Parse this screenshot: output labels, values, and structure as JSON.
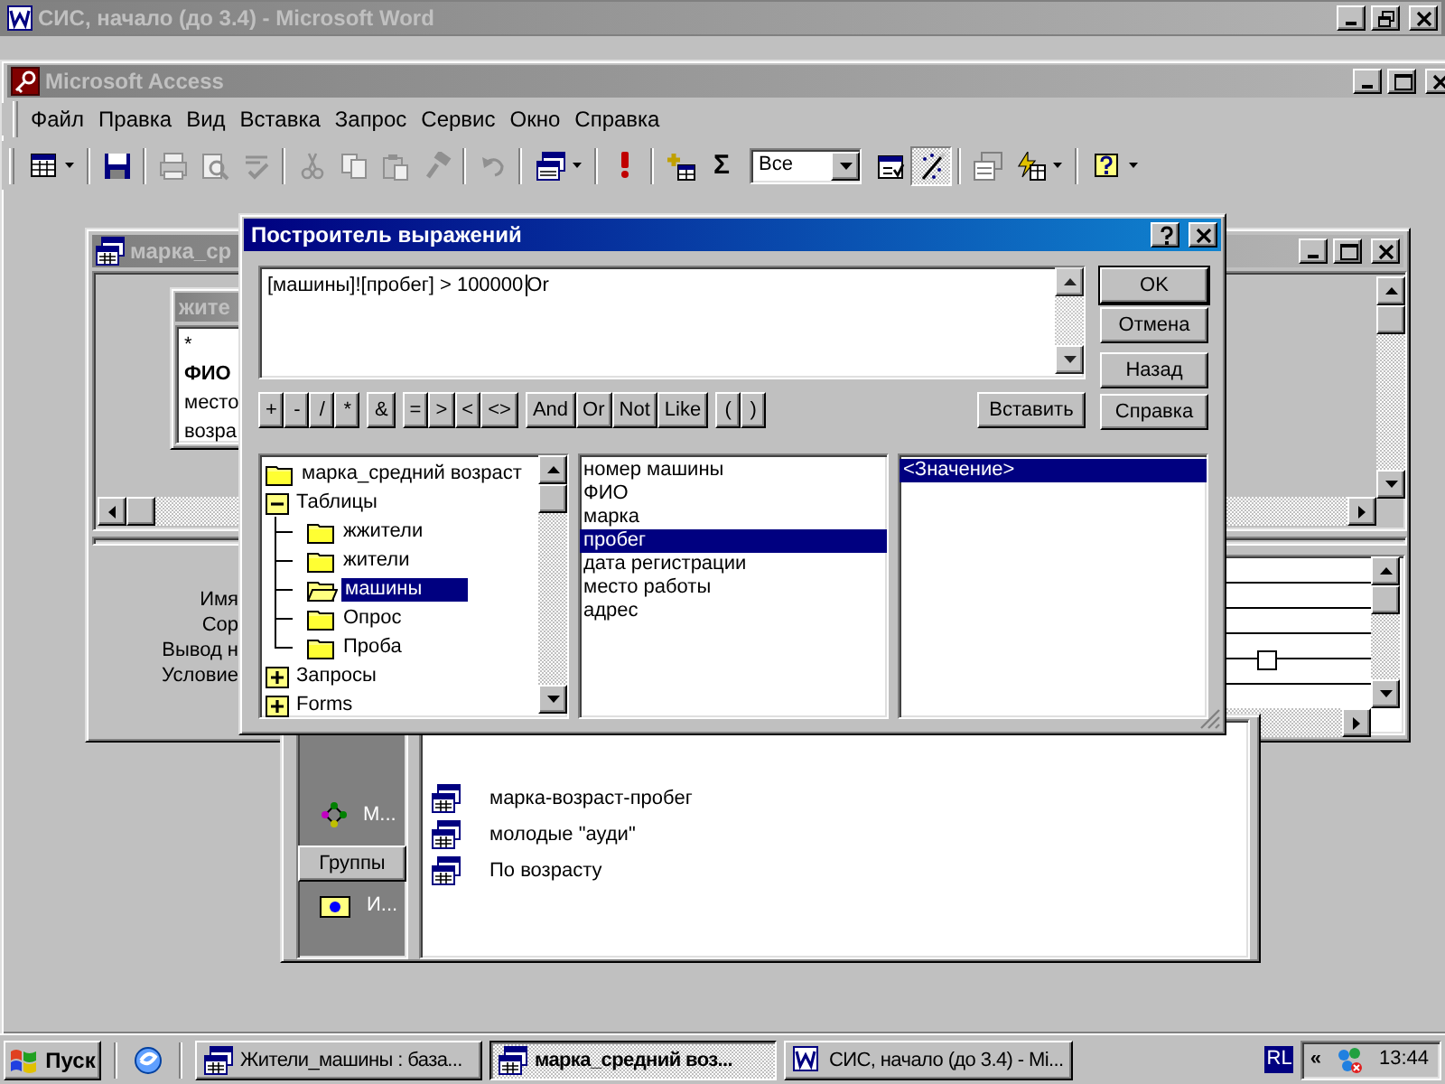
{
  "word_window": {
    "title": "СИС, начало (до 3.4) - Microsoft Word"
  },
  "access_window": {
    "title": "Microsoft Access",
    "menu": [
      "Файл",
      "Правка",
      "Вид",
      "Вставка",
      "Запрос",
      "Сервис",
      "Окно",
      "Справка"
    ],
    "toolbar": [
      {
        "kind": "view",
        "disabled": false,
        "pressed": false
      },
      {
        "kind": "separator"
      },
      {
        "kind": "save",
        "disabled": false,
        "pressed": false
      },
      {
        "kind": "separator"
      },
      {
        "kind": "print",
        "disabled": true,
        "pressed": false
      },
      {
        "kind": "preview",
        "disabled": true,
        "pressed": false
      },
      {
        "kind": "spell",
        "disabled": true,
        "pressed": false
      },
      {
        "kind": "separator"
      },
      {
        "kind": "cut",
        "disabled": true,
        "pressed": false
      },
      {
        "kind": "copy",
        "disabled": true,
        "pressed": false
      },
      {
        "kind": "paste",
        "disabled": true,
        "pressed": false
      },
      {
        "kind": "painter",
        "disabled": true,
        "pressed": false
      },
      {
        "kind": "separator"
      },
      {
        "kind": "undo",
        "disabled": true,
        "pressed": false
      },
      {
        "kind": "separator"
      },
      {
        "kind": "querytype",
        "disabled": false,
        "pressed": false
      },
      {
        "kind": "separator"
      },
      {
        "kind": "run",
        "disabled": false,
        "pressed": false
      },
      {
        "kind": "separator"
      },
      {
        "kind": "showtable",
        "disabled": false,
        "pressed": false
      },
      {
        "kind": "totals",
        "label": "Σ",
        "disabled": false,
        "pressed": false
      },
      {
        "kind": "combo",
        "value": "Все"
      },
      {
        "kind": "properties",
        "disabled": false,
        "pressed": false
      },
      {
        "kind": "build",
        "disabled": false,
        "pressed": true
      },
      {
        "kind": "separator"
      },
      {
        "kind": "dbwindow",
        "disabled": false,
        "pressed": false
      },
      {
        "kind": "newobject",
        "disabled": false,
        "pressed": false
      },
      {
        "kind": "separator"
      },
      {
        "kind": "help",
        "disabled": false,
        "pressed": false
      }
    ]
  },
  "query_window": {
    "title": "марка_ср",
    "table": {
      "title": "жите",
      "fields": [
        {
          "text": "*",
          "bold": false
        },
        {
          "text": "ФИО",
          "bold": true
        },
        {
          "text": "место",
          "bold": false
        },
        {
          "text": "возра",
          "bold": false
        }
      ]
    },
    "grid_labels": [
      "Имя",
      "Сор",
      "Вывод н",
      "Условие"
    ],
    "grid_checkbox": {
      "checked": false
    }
  },
  "database_window": {
    "groups_bar": [
      {
        "kind": "macros",
        "label": "М..."
      },
      {
        "kind": "group_button",
        "label": "Группы"
      },
      {
        "kind": "favorites",
        "label": "И..."
      }
    ],
    "objects": [
      "марка-возраст-пробег",
      "молодые \"ауди\"",
      "По возрасту"
    ]
  },
  "dialog": {
    "title": "Построитель выражений",
    "expression": {
      "before_cursor": "[машины]![пробег] > 100000",
      "after_cursor": "Or"
    },
    "buttons": [
      "OK",
      "Отмена",
      "Назад",
      "Справка"
    ],
    "operator_groups": [
      [
        "+",
        "-",
        "/",
        "*"
      ],
      [
        "&"
      ],
      [
        "=",
        ">",
        "<",
        "<>"
      ],
      [
        "And",
        "Or",
        "Not",
        "Like"
      ],
      [
        "(",
        ")"
      ]
    ],
    "insert_button": "Вставить",
    "tree": [
      {
        "label": "марка_средний возраст",
        "kind": "leaf",
        "selected": false
      },
      {
        "label": "Таблицы",
        "kind": "branch",
        "expanded": true,
        "selected": false,
        "children": [
          {
            "label": "жжители",
            "kind": "leaf",
            "selected": false
          },
          {
            "label": "жители",
            "kind": "leaf",
            "selected": false
          },
          {
            "label": "машины",
            "kind": "leaf",
            "selected": true
          },
          {
            "label": "Опрос",
            "kind": "leaf",
            "selected": false
          },
          {
            "label": "Проба",
            "kind": "leaf",
            "selected": false
          }
        ]
      },
      {
        "label": "Запросы",
        "kind": "branch",
        "expanded": false,
        "selected": false
      },
      {
        "label": "Forms",
        "kind": "branch",
        "expanded": false,
        "selected": false
      }
    ],
    "fields": [
      {
        "label": "номер машины",
        "selected": false
      },
      {
        "label": "ФИО",
        "selected": false
      },
      {
        "label": "марка",
        "selected": false
      },
      {
        "label": "пробег",
        "selected": true
      },
      {
        "label": "дата регистрации",
        "selected": false
      },
      {
        "label": "место работы",
        "selected": false
      },
      {
        "label": "адрес",
        "selected": false
      }
    ],
    "values": [
      {
        "label": "<Значение>",
        "selected": true
      }
    ]
  },
  "taskbar": {
    "start": "Пуск",
    "tasks": [
      {
        "label": "Жители_машины : база...",
        "kind": "database",
        "selected": false
      },
      {
        "label": "марка_средний воз...",
        "kind": "query",
        "selected": true
      },
      {
        "label": "СИС, начало (до 3.4) - Mi...",
        "kind": "word",
        "selected": false
      }
    ],
    "language": "RL",
    "tray_arrows": "«",
    "clock": "13:44"
  }
}
